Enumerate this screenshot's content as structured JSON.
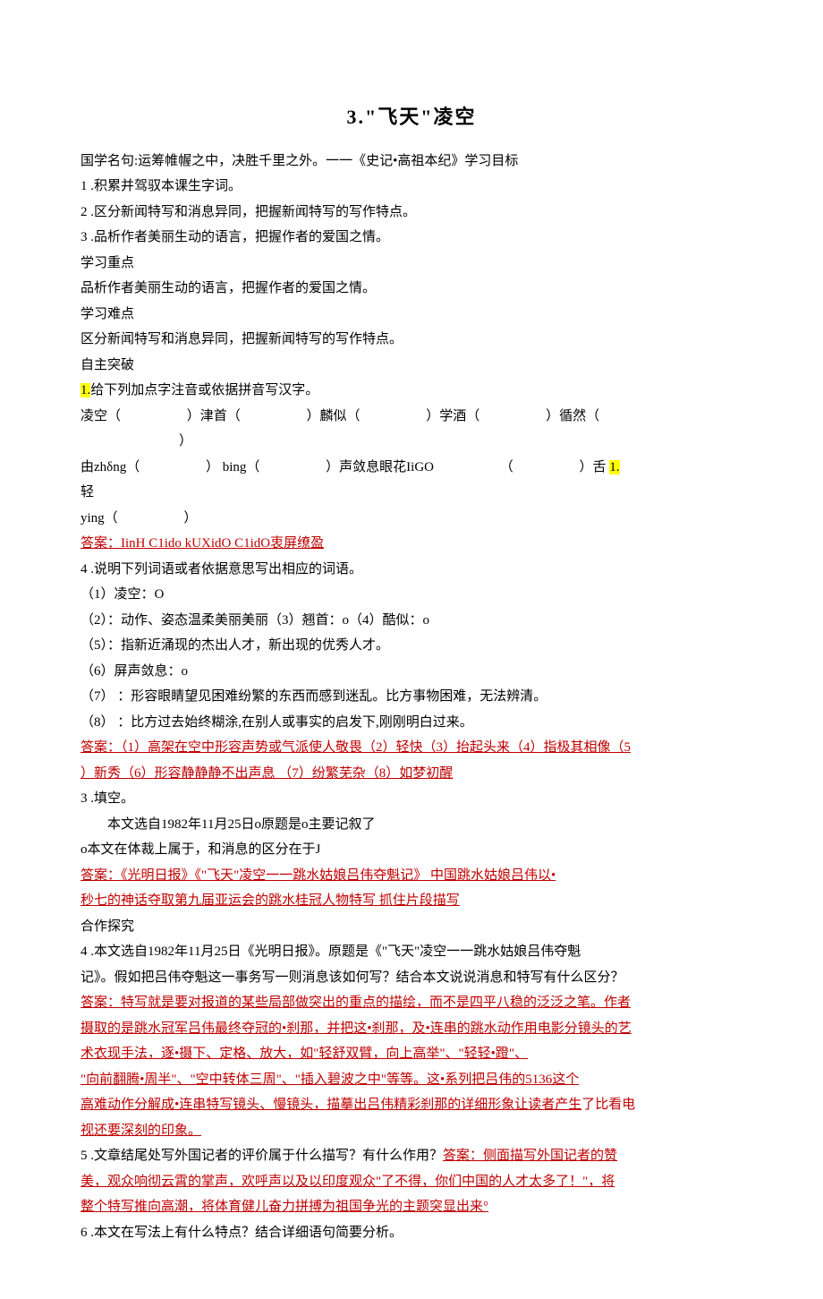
{
  "title": "3.\"飞天\"凌空",
  "p1": "国学名句:运筹帷幄之中，决胜千里之外。一一《史记•高祖本纪》学习目标",
  "p2": "1 .积累并驾驭本课生字词。",
  "p3": "2 .区分新闻特写和消息异同，把握新闻特写的写作特点。",
  "p4": "3 .品析作者美丽生动的语言，把握作者的爱国之情。",
  "p5": "学习重点",
  "p6": "品析作者美丽生动的语言，把握作者的爱国之情。",
  "p7": "学习难点",
  "p8": "区分新闻特写和消息异同，把握新闻特写的写作特点。",
  "p9": "自主突破",
  "hl1": "1.",
  "p10": "给下列加点字注音或依据拼音写汉字。",
  "p11a": "凌空（",
  "p11b": "）津首（",
  "p11c": "）麟似（",
  "p11d": "）学酒（",
  "p11e": "）循然（",
  "p11f": "）",
  "p12a": "由zhδng（",
  "p12b": "）   bing（",
  "p12c": "）声敛息眼花IiGO",
  "p12d": "（",
  "p12e": "）舌",
  "hl2": "1.",
  "p12f": "轻",
  "p13a": "ying（",
  "p13b": "）",
  "ans1": "答案：IinH   C1ido   kUXidO       C1idO衷屏缭盈",
  "p14": "4 .说明下列词语或者依据意思写出相应的词语。",
  "p15": "（1）凌空：O",
  "p16": "（2）：动作、姿态温柔美丽美丽（3）翘首：o（4）酷似：o",
  "p17": "（5）：指新近涌现的杰出人才，新出现的优秀人才。",
  "p18": "（6）屏声敛息：o",
  "p19": "（7）                     ：形容眼睛望见困难纷繁的东西而感到迷乱。比方事物困难，无法辨清。",
  "p20": "（8）                     ：比方过去始终糊涂,在别人或事实的启发下,刚刚明白过来。",
  "ans2a": "答案：（1）高架在空中形容声势或气派使人敬畏（2）轻快（3）抬起头来（4）指极其相像（5",
  "ans2b": "）新秀（6）形容静静静不出声息                     （7）纷繁芜杂（8）如梦初醒",
  "p21": "3 .填空。",
  "p22": "本文选自1982年11月25日o原题是o主要记叙了",
  "p23": "o本文在体裁上属于，和消息的区分在于J",
  "ans3a": "答案：《光明日报》《\"飞天\"凌空一一跳水姑娘吕伟夺魁记》       中国跳水姑娘吕伟以•",
  "ans3b": "秒七的神话夺取第九届亚运会的跳水桂冠人物特写            抓住片段描写",
  "p24": "合作探究",
  "p25": "4 .本文选自1982年11月25日《光明日报》。原题是《\"飞天\"凌空一一跳水姑娘吕伟夺魁",
  "p26": "记》。假如把吕伟夺魁这一事务写一则消息该如何写？结合本文说说消息和特写有什么区分？",
  "ans4a": "答案：特写就是要对报道的某些局部做突出的重点的描绘，而不是四平八稳的泛泛之笔。作者",
  "ans4b": "摄取的是跳水冠军吕伟最终夺冠的•刹那，并把这•刹那，及•连串的跳水动作用电影分镜头的艺",
  "ans4c": "术衣现手法，逐•摄下、定格、放大，如\"轻舒双臂，向上高举\"、\"轻轻•蹬\"、",
  "ans4d": "\"向前翻腾•周半\"、\"空中转体三周\"、\"插入碧波之中\"等等。这•系列把吕伟的5136这个",
  "ans4e": "高难动作分解成•连串特写镜头、慢镜头，描摹出吕伟精彩刹那的详细形象让读者产生",
  "ans4e2": "了比看电",
  "ans4f": "视还要深刻的印象。",
  "p27": "5 .文章结尾处写外国记者的评价属于什么描写？有什么作用？",
  "ans5a": "答案：侧面描写外国记者的赞",
  "ans5b": "美，观众响彻云霄的掌声，欢呼声以及以印度观众\"了不得，你们中国的人才太多了！\"，将",
  "ans5c": "整个特写推向高潮，将体育健儿奋力拼搏为祖国争光的主题突显出来°",
  "p28": "6 .本文在写法上有什么特点？结合详细语句简要分析。"
}
